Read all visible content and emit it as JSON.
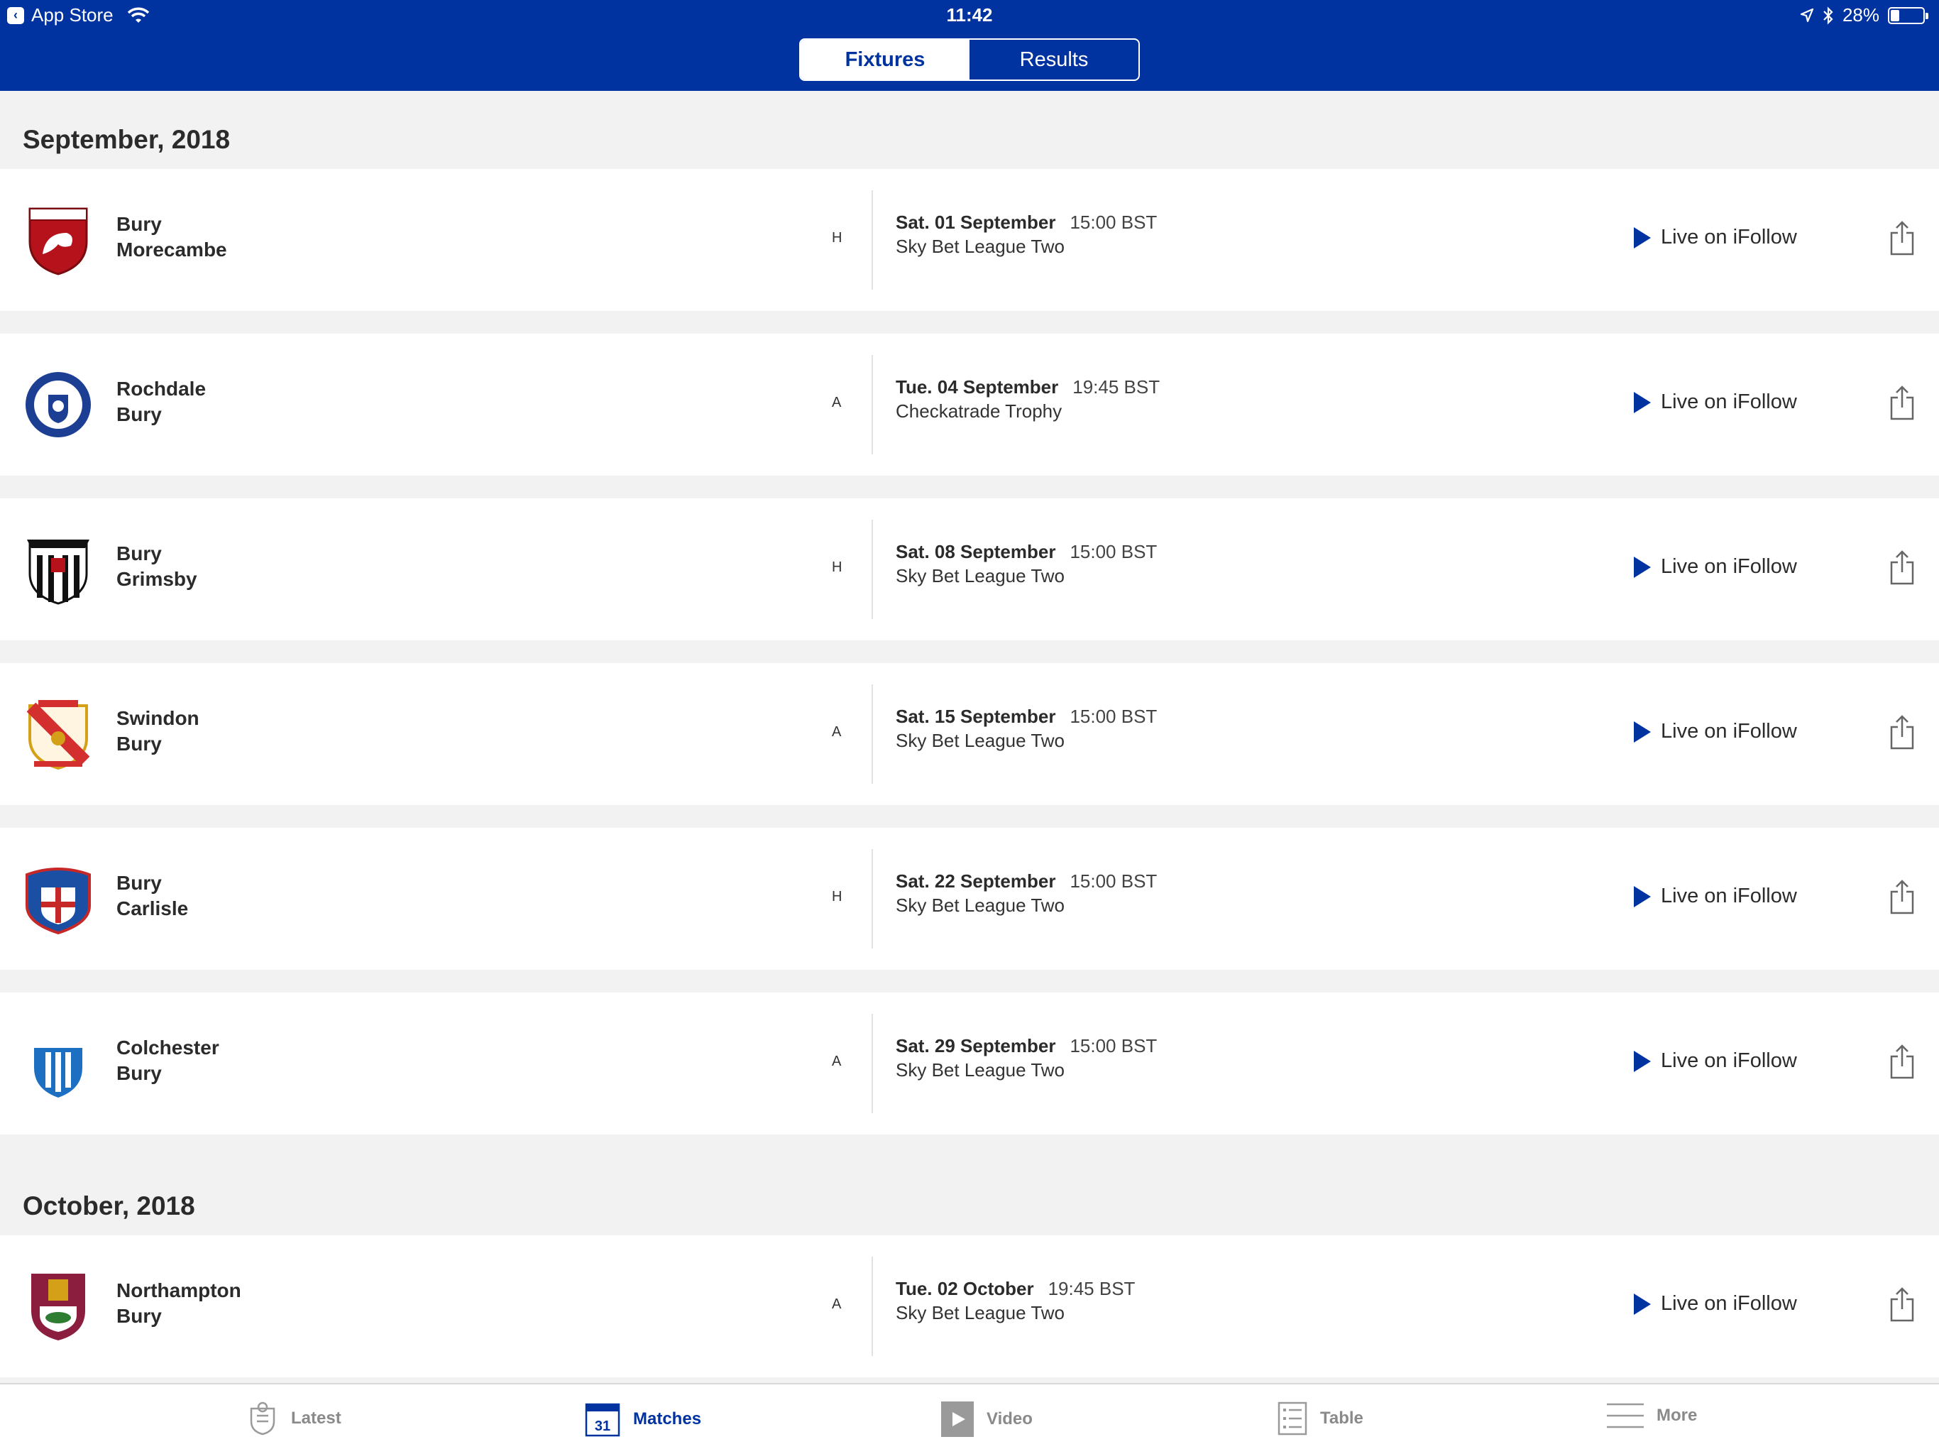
{
  "status_bar": {
    "back_app": "App Store",
    "time": "11:42",
    "battery": "28%",
    "battery_level": 0.28
  },
  "segments": [
    {
      "label": "Fixtures",
      "active": true
    },
    {
      "label": "Results",
      "active": false
    }
  ],
  "months": [
    {
      "title": "September, 2018",
      "fixtures": [
        {
          "home": "Bury",
          "away": "Morecambe",
          "venue": "H",
          "date": "Sat. 01 September",
          "time": "15:00 BST",
          "competition": "Sky Bet League Two",
          "live": "Live on iFollow",
          "crest": "morecambe-crest-icon",
          "crest_color": "#b5121b"
        },
        {
          "home": "Rochdale",
          "away": "Bury",
          "venue": "A",
          "date": "Tue. 04 September",
          "time": "19:45 BST",
          "competition": "Checkatrade Trophy",
          "live": "Live on iFollow",
          "crest": "rochdale-crest-icon",
          "crest_color": "#1c3f94"
        },
        {
          "home": "Bury",
          "away": "Grimsby",
          "venue": "H",
          "date": "Sat. 08 September",
          "time": "15:00 BST",
          "competition": "Sky Bet League Two",
          "live": "Live on iFollow",
          "crest": "grimsby-crest-icon",
          "crest_color": "#111111"
        },
        {
          "home": "Swindon",
          "away": "Bury",
          "venue": "A",
          "date": "Sat. 15 September",
          "time": "15:00 BST",
          "competition": "Sky Bet League Two",
          "live": "Live on iFollow",
          "crest": "swindon-crest-icon",
          "crest_color": "#d32f2f"
        },
        {
          "home": "Bury",
          "away": "Carlisle",
          "venue": "H",
          "date": "Sat. 22 September",
          "time": "15:00 BST",
          "competition": "Sky Bet League Two",
          "live": "Live on iFollow",
          "crest": "carlisle-crest-icon",
          "crest_color": "#1a4fa3"
        },
        {
          "home": "Colchester",
          "away": "Bury",
          "venue": "A",
          "date": "Sat. 29 September",
          "time": "15:00 BST",
          "competition": "Sky Bet League Two",
          "live": "Live on iFollow",
          "crest": "colchester-crest-icon",
          "crest_color": "#1d6fc1"
        }
      ]
    },
    {
      "title": "October, 2018",
      "fixtures": [
        {
          "home": "Northampton",
          "away": "Bury",
          "venue": "A",
          "date": "Tue. 02 October",
          "time": "19:45 BST",
          "competition": "Sky Bet League Two",
          "live": "Live on iFollow",
          "crest": "northampton-crest-icon",
          "crest_color": "#8b1e3f"
        }
      ]
    }
  ],
  "tabs": [
    {
      "label": "Latest",
      "icon": "latest-crest-icon",
      "active": false
    },
    {
      "label": "Matches",
      "icon": "calendar-icon",
      "active": true,
      "badge": "31"
    },
    {
      "label": "Video",
      "icon": "video-play-icon",
      "active": false
    },
    {
      "label": "Table",
      "icon": "table-list-icon",
      "active": false
    },
    {
      "label": "More",
      "icon": "menu-icon",
      "active": false
    }
  ],
  "colors": {
    "brand_blue": "#0033a0",
    "background": "#f2f2f2",
    "tab_inactive": "#8a8a8a"
  }
}
